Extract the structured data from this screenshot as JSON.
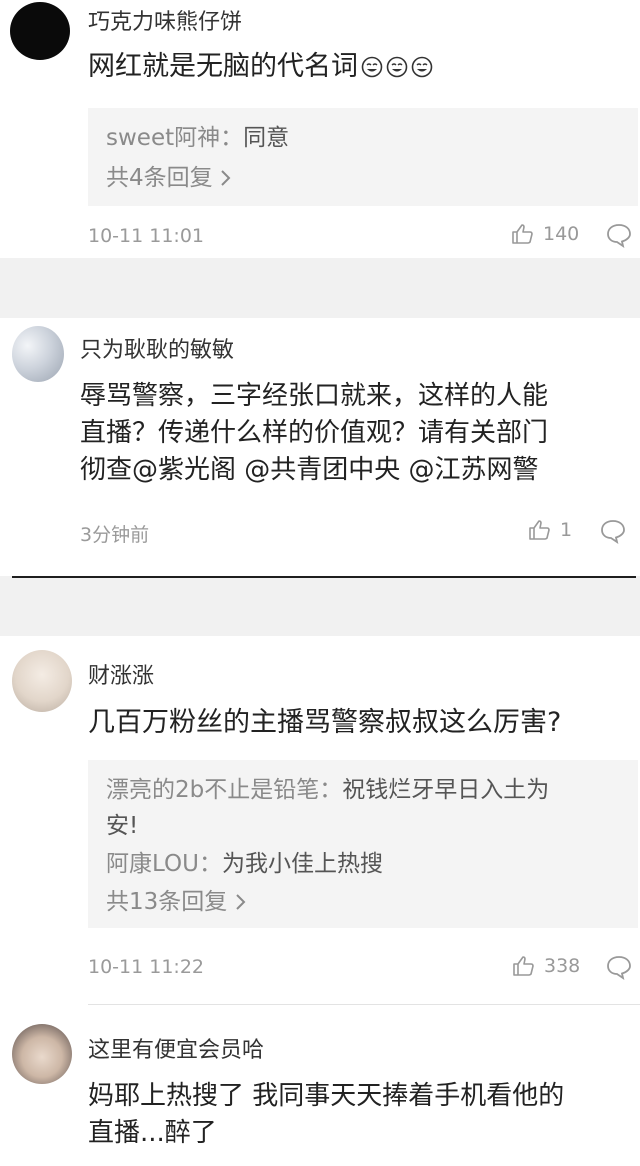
{
  "comments": [
    {
      "username": "巧克力味熊仔饼",
      "text": "网红就是无脑的代名词",
      "replies": [
        {
          "user": "sweet阿神",
          "sep": "：",
          "text": "同意"
        }
      ],
      "more_replies": "共4条回复",
      "time": "10-11 11:01",
      "likes": "140"
    },
    {
      "username": "只为耿耿的敏敏",
      "text_lines": [
        "辱骂警察，三字经张口就来，这样的人能",
        "直播？传递什么样的价值观？请有关部门",
        "彻查@紫光阁 @共青团中央 @江苏网警"
      ],
      "time": "3分钟前",
      "likes": "1"
    },
    {
      "username": "财涨涨",
      "text": "几百万粉丝的主播骂警察叔叔这么厉害?",
      "replies": [
        {
          "user": "漂亮的2b不止是铅笔",
          "sep": "：",
          "text": "祝钱烂牙早日入土为",
          "text_cont": "安!"
        },
        {
          "user": "阿康LOU",
          "sep": "：",
          "text": "为我小佳上热搜"
        }
      ],
      "more_replies": "共13条回复",
      "time": "10-11 11:22",
      "likes": "338"
    },
    {
      "username": "这里有便宜会员哈",
      "text_lines": [
        "妈耶上热搜了 我同事天天捧着手机看他的",
        "直播...醉了"
      ]
    }
  ],
  "icons": {
    "like": "thumbs-up-icon",
    "comment": "comment-bubble-icon",
    "emoji": "crying-laughing-emoji-icon",
    "more": "chevron-right-icon"
  },
  "colors": {
    "background": "#f1f1f1",
    "card": "#ffffff",
    "reply_bg": "#f4f4f4",
    "muted": "#9a9a9a"
  }
}
